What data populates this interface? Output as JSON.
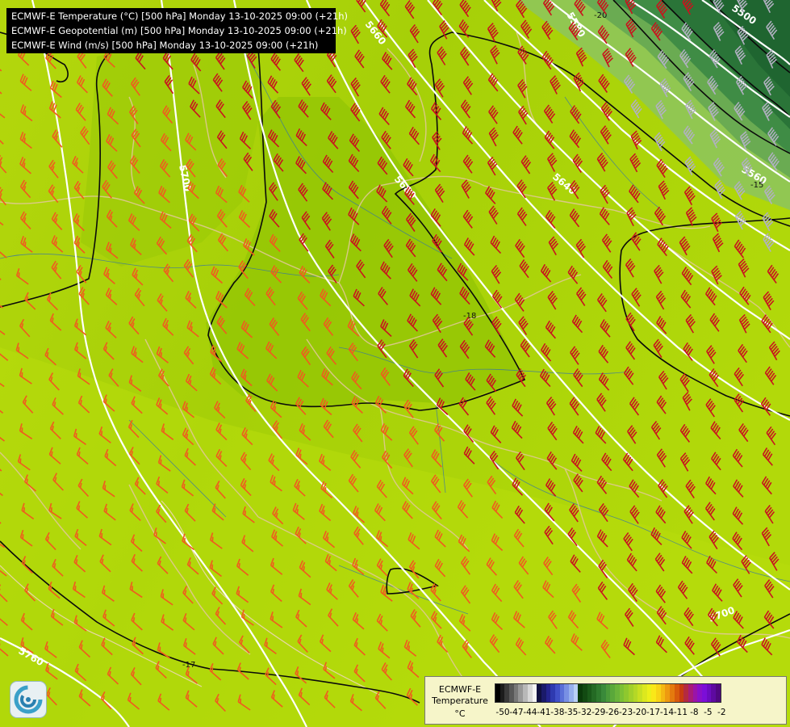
{
  "header": {
    "lines": [
      "ECMWF-E Temperature (°C) [500 hPa] Monday 13-10-2025 09:00 (+21h)",
      "ECMWF-E Geopotential (m) [500 hPa] Monday 13-10-2025 09:00 (+21h)",
      "ECMWF-E Wind (m/s) [500 hPa] Monday 13-10-2025 09:00 (+21h)"
    ]
  },
  "contours": {
    "geopotential_labels": [
      "5660",
      "5700",
      "5680",
      "5640",
      "5560",
      "5500",
      "5700",
      "5760",
      "5580"
    ],
    "temperature_labels": [
      "-17",
      "-20",
      "-18",
      "-15"
    ]
  },
  "legend": {
    "title": "ECMWF-E Temperature",
    "unit": "°C",
    "tick_labels": [
      "-50",
      "-47",
      "-44",
      "-41",
      "-38",
      "-35",
      "-32",
      "-29",
      "-26",
      "-23",
      "-20",
      "-17",
      "-14",
      "-11",
      "-8",
      "-5",
      "-2"
    ],
    "colors": [
      "#000000",
      "#1c1c1c",
      "#3a3a3a",
      "#585858",
      "#787878",
      "#989898",
      "#b8b8b8",
      "#d8d8d8",
      "#f4f4f4",
      "#101040",
      "#1a1a6a",
      "#242490",
      "#2e3ab0",
      "#4050c8",
      "#5a70d8",
      "#7890e4",
      "#96b0ee",
      "#b8d0f6",
      "#0a3a0a",
      "#124a12",
      "#1a5a1a",
      "#246a24",
      "#2e7a2e",
      "#3a8a3a",
      "#4a9a3a",
      "#5aa83a",
      "#6ab43a",
      "#7cc034",
      "#8ec82e",
      "#a2d02a",
      "#b4d826",
      "#c8e022",
      "#dce81e",
      "#ecf01a",
      "#fae818",
      "#f8d416",
      "#f4b812",
      "#ee9a10",
      "#e47a0e",
      "#d85a0c",
      "#c83c10",
      "#b42a40",
      "#a81c78",
      "#9a14a8",
      "#8a10c8",
      "#7c0ed8",
      "#6c0cc0",
      "#5e0aa0",
      "#500880"
    ],
    "colors_main": [
      "#0a3a0a",
      "#1a5a1a",
      "#2e7a2e",
      "#4a9a3a",
      "#6ab43a",
      "#8ec82e",
      "#a2d02a",
      "#b8dc24",
      "#cce41e"
    ]
  },
  "map": {
    "palette": {
      "field_light": "#b6d90b",
      "field_mid": "#a4cf08",
      "field_dark": "#8fc306",
      "cold_core": "#2d7a3a",
      "border": "#e0c994",
      "river": "#2a6ab8",
      "barb_warm": "#f05a1e",
      "barb_red": "#c8141e",
      "barb_cold": "#b0b0c0"
    }
  }
}
